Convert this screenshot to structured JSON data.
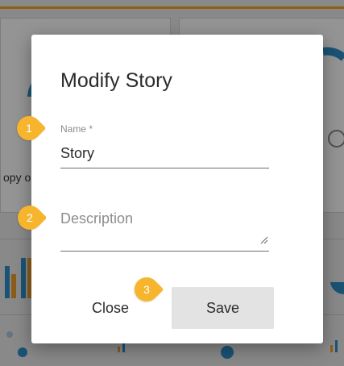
{
  "modal": {
    "title": "Modify Story",
    "name_label": "Name *",
    "name_value": "Story",
    "description_placeholder": "Description",
    "close_label": "Close",
    "save_label": "Save"
  },
  "steps": [
    "1",
    "2",
    "3"
  ],
  "background": {
    "partial_text": "opy o"
  },
  "colors": {
    "accent": "#f6b52c",
    "topbar": "#f6a623",
    "save_button_bg": "#e3e3e3"
  }
}
